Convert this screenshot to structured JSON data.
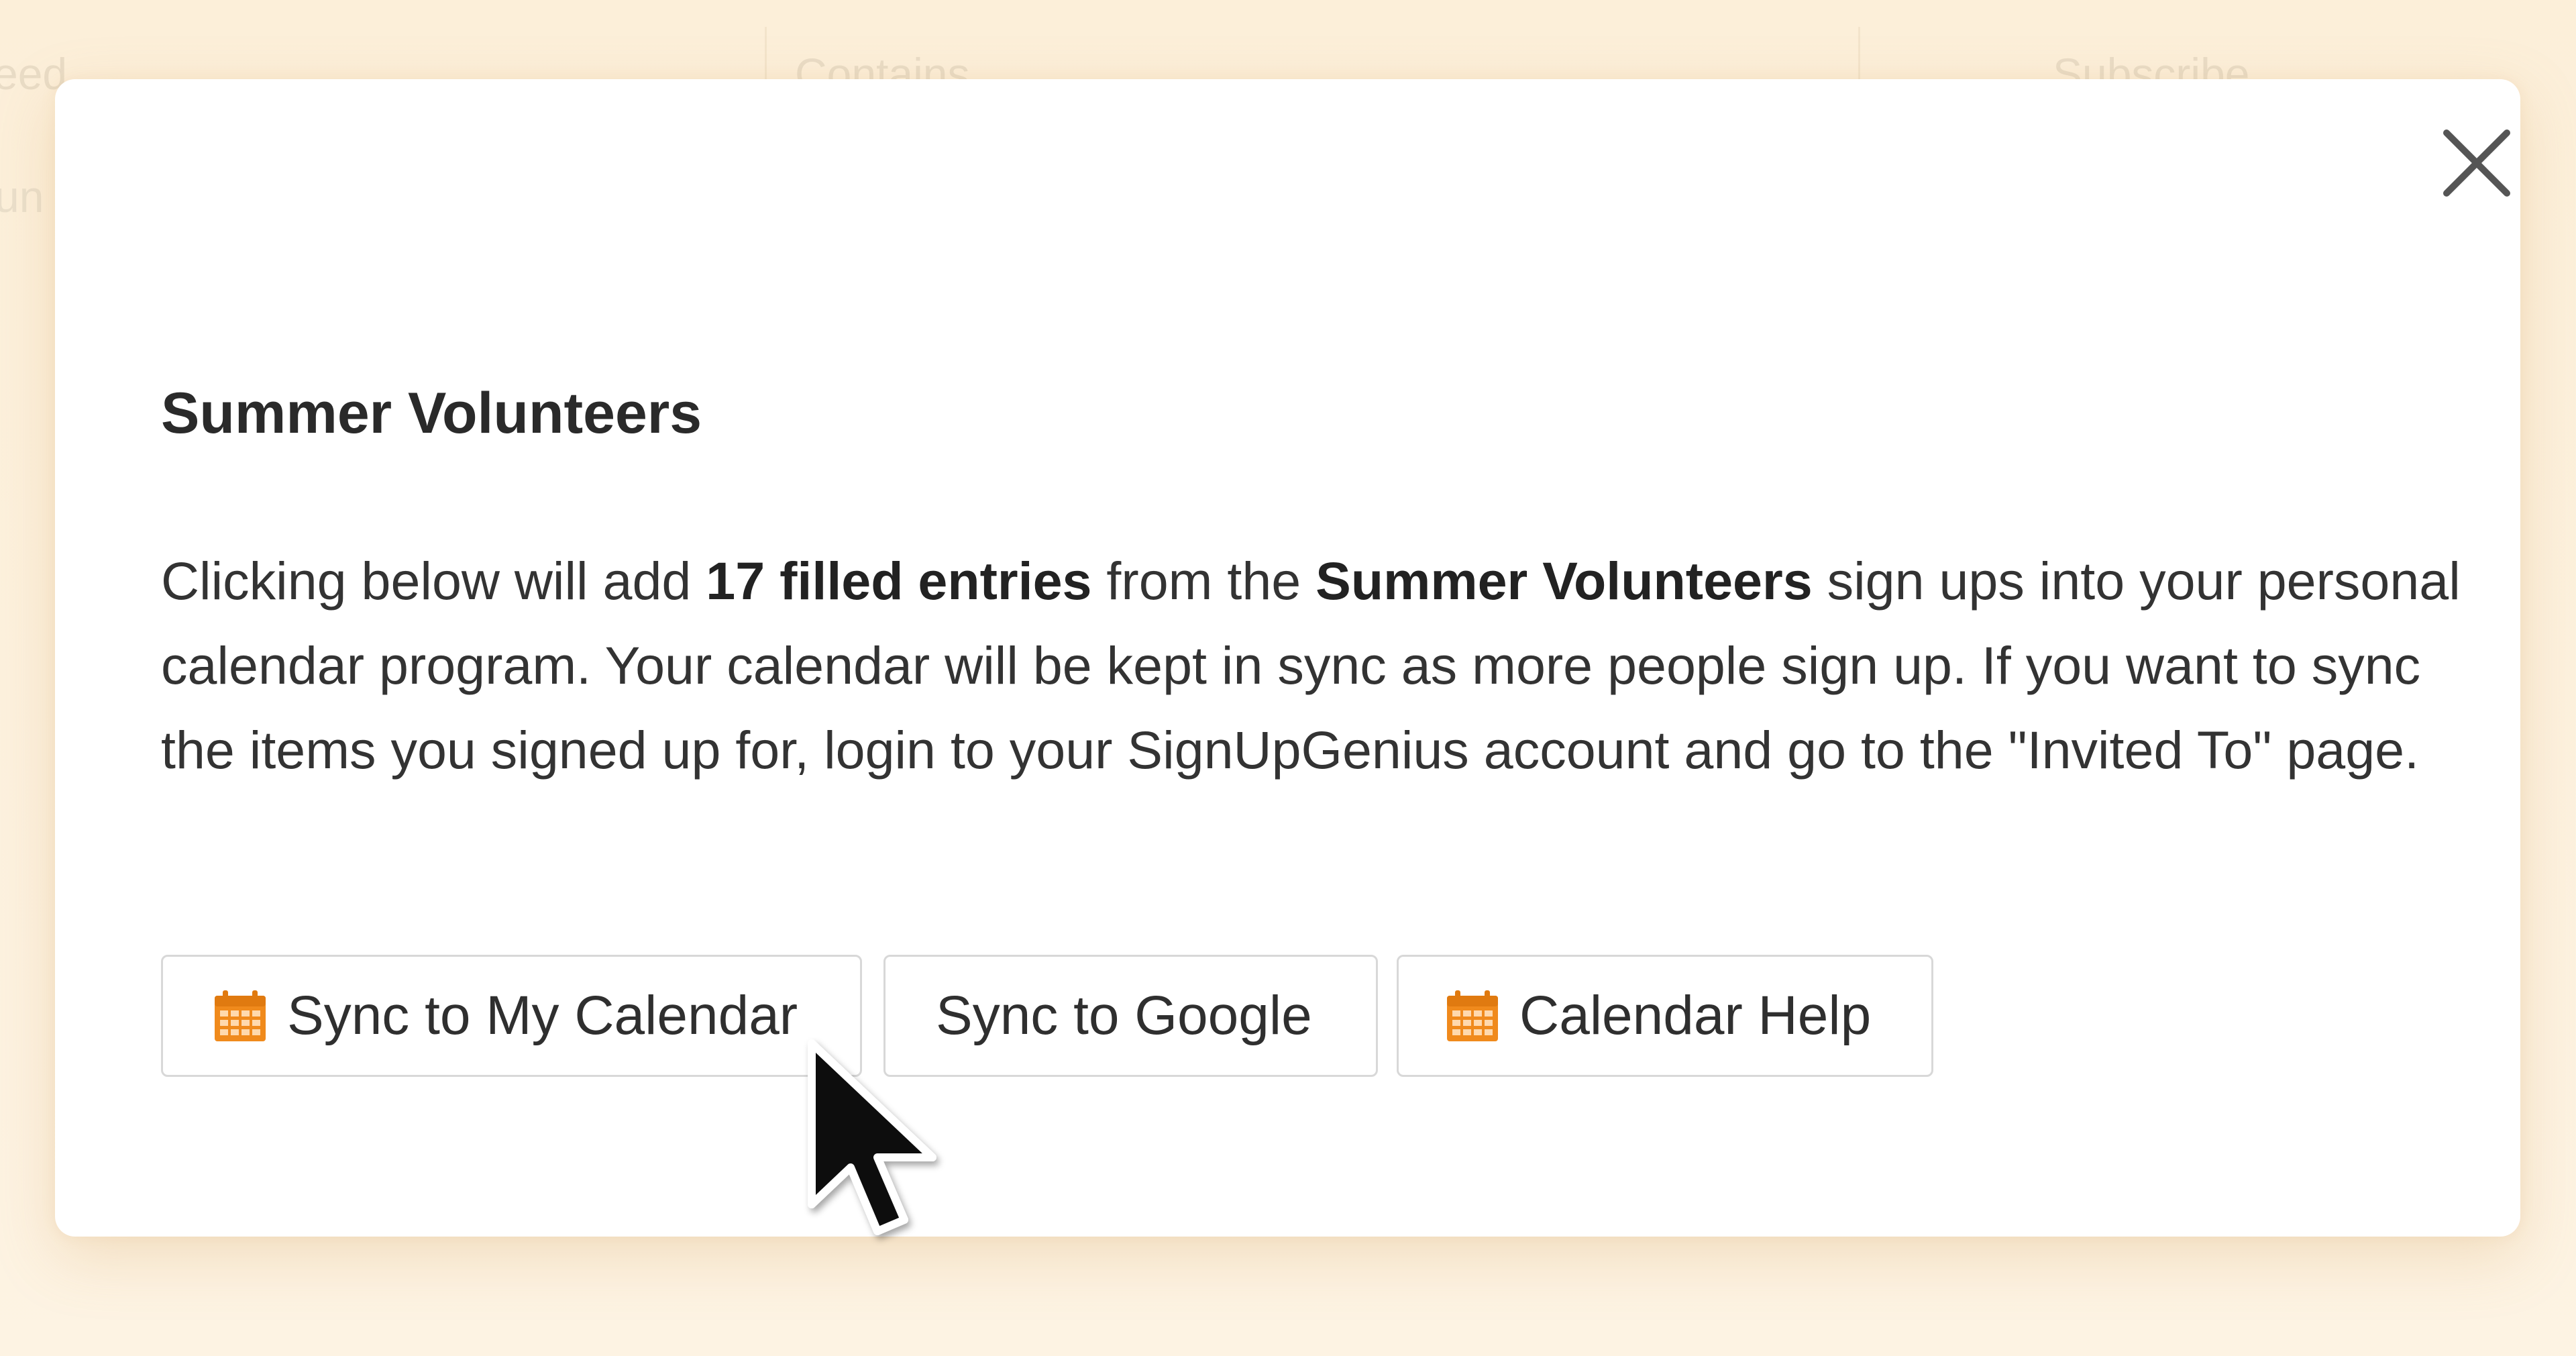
{
  "background": {
    "header_cells": [
      "eed",
      "Contains",
      "Subscribe"
    ],
    "row2_text": "un"
  },
  "modal": {
    "title": "Summer Volunteers",
    "desc": {
      "part1": "Clicking below will add ",
      "count": "17 filled entries",
      "part2": " from the ",
      "group": "Summer Volunteers",
      "part3": " sign ups into your personal calendar program. Your calendar will be kept in sync as more people sign up. If you want to sync the items you signed up for, login to your SignUpGenius account and go to the \"Invited To\" page."
    },
    "buttons": {
      "sync_calendar": "Sync to My Calendar",
      "sync_google": "Sync to Google",
      "calendar_help": "Calendar Help"
    }
  },
  "colors": {
    "accent_orange": "#f08a1c",
    "backdrop": "#fdf0db"
  },
  "icons": {
    "close": "close-icon",
    "calendar": "calendar-icon",
    "cursor": "mouse-pointer-icon"
  }
}
